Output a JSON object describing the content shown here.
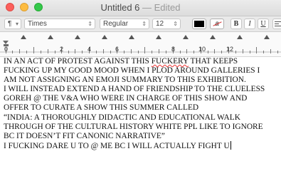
{
  "window": {
    "title": "Untitled 6",
    "separator": "—",
    "status": "Edited"
  },
  "toolbar": {
    "paragraph_style": "¶",
    "font_family": "Times",
    "font_style": "Regular",
    "font_size": "12",
    "bold_label": "B",
    "italic_label": "I",
    "underline_label": "U",
    "text_color": "#000000",
    "highlight_label": "a"
  },
  "ruler": {
    "labels": [
      "0",
      "2",
      "4",
      "6",
      "8",
      "10",
      "12"
    ]
  },
  "document": {
    "lines": [
      "IN AN ACT OF PROTEST AGAINST THIS FUCKERY THAT KEEPS",
      "FUCKING UP MY GOOD MOOD WHEN I PLOD AROUND GALLERIES I",
      "AM NOT ASSIGNING AN EMOJI SUMMARY TO THIS EXHIBITION.",
      "I WILL INSTEAD EXTEND A HAND OF FRIENDSHIP TO THE CLUELESS",
      "GOREH @ THE V&A WHO WERE IN CHARGE OF THIS SHOW AND",
      "OFFER TO CURATE A SHOW THIS SUMMER CALLED",
      "“INDIA: A THOROUGHLY DIDACTIC AND EDUCATIONAL WALK",
      "THROUGH OF THE CULTURAL HISTORY WHITE PPL LIKE TO IGNORE",
      "BC IT DOESN’T FIT CANONIC NARRATIVE”",
      "I FUCKING DARE U TO @ ME BC I WILL ACTUALLY FIGHT U"
    ]
  }
}
